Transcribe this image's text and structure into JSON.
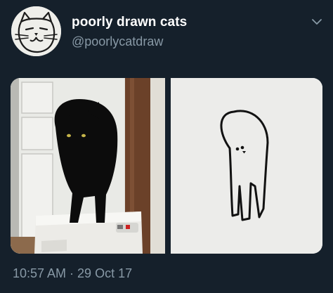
{
  "tweet": {
    "display_name": "poorly drawn cats",
    "handle": "@poorlycatdraw",
    "timestamp": "10:57 AM · 29 Oct 17"
  },
  "icons": {
    "caret": "chevron-down-icon",
    "avatar": "doodle-cat-face"
  },
  "colors": {
    "background": "#15202b",
    "secondary_text": "#8899a6",
    "primary_text": "#ffffff"
  }
}
